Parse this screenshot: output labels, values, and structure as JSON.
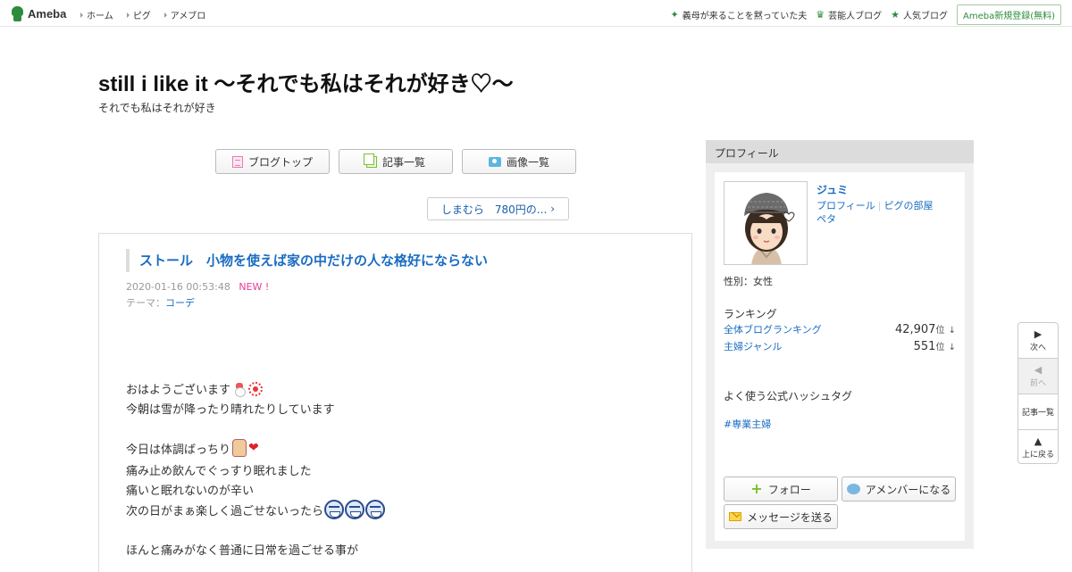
{
  "topbar": {
    "logo": "Ameba",
    "nav": [
      "ホーム",
      "ピグ",
      "アメブロ"
    ],
    "right_links": [
      {
        "label": "義母が来ることを黙っていた夫",
        "icon": "sparkle-icon"
      },
      {
        "label": "芸能人ブログ",
        "icon": "crown-icon"
      },
      {
        "label": "人気ブログ",
        "icon": "star-icon"
      }
    ],
    "register": "Ameba新規登録(無料)"
  },
  "blog": {
    "title": "still i like it 〜それでも私はそれが好き♡〜",
    "description": "それでも私はそれが好き"
  },
  "nav_buttons": {
    "top": "ブログトップ",
    "list": "記事一覧",
    "images": "画像一覧"
  },
  "prev_post": "しまむら　780円の...",
  "article": {
    "title": "ストール　小物を使えば家の中だけの人な格好にならない",
    "date": "2020-01-16 00:53:48",
    "new_label": "NEW !",
    "theme_label": "テーマ：",
    "theme": "コーデ",
    "lines": [
      "おはようございます",
      "今朝は雪が降ったり晴れたりしています",
      "今日は体調ばっちり",
      "痛み止め飲んでぐっすり眠れました",
      "痛いと眠れないのが辛い",
      "次の日がまぁ楽しく過ごせないったら",
      "ほんと痛みがなく普通に日常を過ごせる事が"
    ]
  },
  "sidebar": {
    "header": "プロフィール",
    "name": "ジュミ",
    "links": [
      "プロフィール",
      "ピグの部屋",
      "ペタ"
    ],
    "gender": "性別：女性",
    "ranking_title": "ランキング",
    "rankings": [
      {
        "label": "全体ブログランキング",
        "value": "42,907",
        "unit": "位",
        "trend": "↓"
      },
      {
        "label": "主婦ジャンル",
        "value": "551",
        "unit": "位",
        "trend": "↓"
      }
    ],
    "hashtag_title": "よく使う公式ハッシュタグ",
    "hashtag": "#専業主婦",
    "follow": "フォロー",
    "amember": "アメンバーになる",
    "message": "メッセージを送る"
  },
  "pager": {
    "next": "次へ",
    "prev": "前へ",
    "list": "記事一覧",
    "top": "上に戻る"
  }
}
